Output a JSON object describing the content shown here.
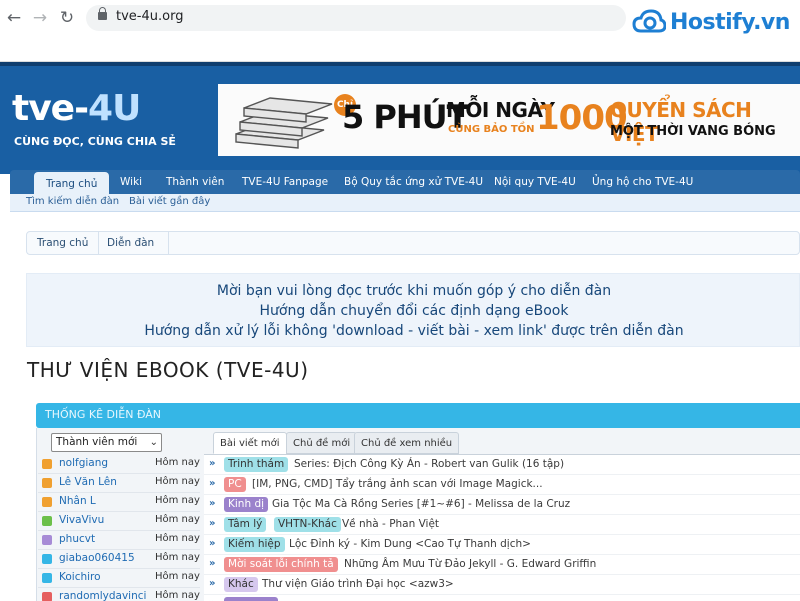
{
  "browser": {
    "url": "tve-4u.org",
    "back_icon": "←",
    "forward_icon": "→",
    "reload_icon": "↻"
  },
  "watermark": {
    "text": "Hostify.vn",
    "color": "#1e7fd3"
  },
  "site": {
    "logo_main": "tve-",
    "logo_accent": "4U",
    "tagline": "CÙNG ĐỌC, CÙNG CHIA SẺ",
    "banner": {
      "badge": "Chỉ",
      "big": "5 PHÚT",
      "mid": "MỖI NGÀY",
      "sub": "CÙNG BẢO TỒN",
      "number": "1000",
      "right_top": "QUYỂN SÁCH VIỆT",
      "right_bottom": "MỘT THỜI VANG BÓNG"
    }
  },
  "nav": {
    "tabs": [
      {
        "label": "Trang chủ",
        "active": true
      },
      {
        "label": "Wiki"
      },
      {
        "label": "Thành viên"
      },
      {
        "label": "TVE-4U Fanpage"
      },
      {
        "label": "Bộ Quy tắc ứng xử TVE-4U"
      },
      {
        "label": "Nội quy TVE-4U"
      },
      {
        "label": "Ủng hộ cho TVE-4U"
      }
    ],
    "subnav": [
      "Tìm kiếm diễn đàn",
      "Bài viết gần đây"
    ]
  },
  "breadcrumb": [
    "Trang chủ",
    "Diễn đàn"
  ],
  "notices": [
    "Mời bạn vui lòng đọc trước khi muốn góp ý cho diễn đàn",
    "Hướng dẫn chuyển đổi các định dạng eBook",
    "Hướng dẫn xử lý lỗi không 'download - viết bài - xem link' được trên diễn đàn"
  ],
  "page_title": "THƯ VIỆN EBOOK (TVE-4U)",
  "stats": {
    "header": "THỐNG KÊ DIỄN ĐÀN",
    "member_select": "Thành viên mới",
    "members": [
      {
        "name": "nolfgiang",
        "time": "Hôm nay",
        "color": "#f0a030"
      },
      {
        "name": "Lê Văn Lên",
        "time": "Hôm nay",
        "color": "#f0a030"
      },
      {
        "name": "Nhân L",
        "time": "Hôm nay",
        "color": "#f0a030"
      },
      {
        "name": "VivaVivu",
        "time": "Hôm nay",
        "color": "#6cc04a"
      },
      {
        "name": "phucvt",
        "time": "Hôm nay",
        "color": "#a78bd6"
      },
      {
        "name": "giabao060415",
        "time": "Hôm nay",
        "color": "#35b6e6"
      },
      {
        "name": "Koichiro",
        "time": "Hôm nay",
        "color": "#35b6e6"
      },
      {
        "name": "randomlydavinci",
        "time": "Hôm nay",
        "color": "#e55f5f"
      }
    ],
    "tabs": [
      "Bài viết mới",
      "Chủ đề mới",
      "Chủ đề xem nhiều"
    ],
    "topics": [
      {
        "prefixes": [
          {
            "label": "Trinh thám",
            "bg": "#9fe0e8"
          }
        ],
        "title": "Series: Địch Công Kỳ Án - Robert van Gulik (16 tập)"
      },
      {
        "prefixes": [
          {
            "label": "PC",
            "bg": "#f08f8f",
            "fg": "#fff"
          }
        ],
        "title": "[IM, PNG, CMD] Tẩy trắng ảnh scan với Image Magick..."
      },
      {
        "prefixes": [
          {
            "label": "Kinh dị",
            "bg": "#9b82cc",
            "fg": "#fff"
          }
        ],
        "title": "Gia Tộc Ma Cà Rồng Series [#1~#6] - Melissa de la Cruz"
      },
      {
        "prefixes": [
          {
            "label": "Tâm lý",
            "bg": "#9fe0e8"
          },
          {
            "label": "VHTN-Khác",
            "bg": "#9fe0e8"
          }
        ],
        "title": "Về nhà - Phan Việt"
      },
      {
        "prefixes": [
          {
            "label": "Kiếm hiệp",
            "bg": "#9fe0e8"
          }
        ],
        "title": "Lộc Đỉnh ký - Kim Dung <Cao Tự Thanh dịch>"
      },
      {
        "prefixes": [
          {
            "label": "Mời soát lỗi chính tả",
            "bg": "#f08f8f",
            "fg": "#fff"
          }
        ],
        "title": "Những Âm Mưu Từ Đảo Jekyll - G. Edward Griffin"
      },
      {
        "prefixes": [
          {
            "label": "Khác",
            "bg": "#d6c8ee"
          }
        ],
        "title": "Thư viện Giáo trình Đại học <azw3>"
      },
      {
        "prefixes": [
          {
            "label": "",
            "bg": "#9b82cc"
          }
        ],
        "title": ""
      }
    ]
  }
}
